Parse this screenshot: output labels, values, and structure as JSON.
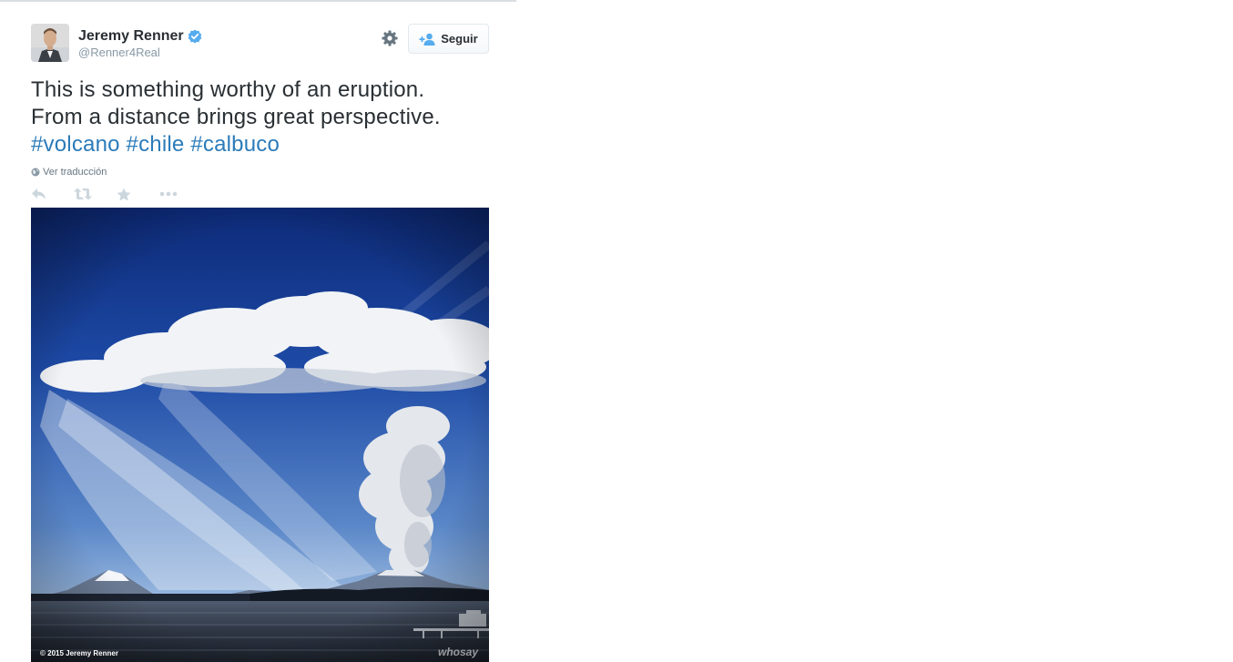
{
  "user": {
    "name": "Jeremy Renner",
    "handle": "@Renner4Real",
    "verified": true
  },
  "follow_button": {
    "label": "Seguir",
    "icon": "add-user-icon"
  },
  "settings_icon": "gear-icon",
  "tweet": {
    "line1": "This is something worthy of an eruption.",
    "line2": "From a distance brings great perspective.",
    "hashtags": [
      "#volcano",
      "#chile",
      "#calbuco"
    ]
  },
  "translate_link": "Ver traducción",
  "actions": [
    "reply-icon",
    "retweet-icon",
    "favorite-icon",
    "more-icon"
  ],
  "media": {
    "credit": "© 2015 Jeremy Renner",
    "watermark": "whosay"
  },
  "colors": {
    "link": "#2b7bb9",
    "text": "#292f33",
    "muted": "#8899a6",
    "verified": "#55acee"
  }
}
